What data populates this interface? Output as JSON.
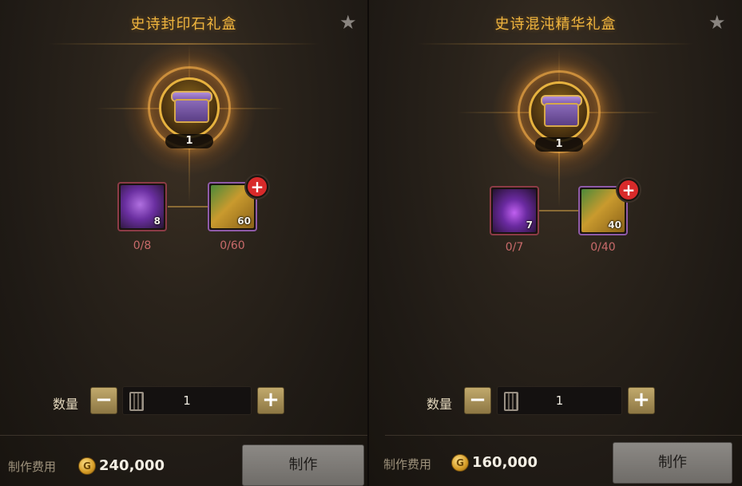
{
  "panels": [
    {
      "title": "史诗封印石礼盒",
      "main_count": "1",
      "materials": [
        {
          "count": "8",
          "progress": "0/8",
          "icon": "purple-crystal-icon"
        },
        {
          "count": "60",
          "progress": "0/60",
          "icon": "gold-bars-icon",
          "badge": "+"
        }
      ],
      "quantity_label": "数量",
      "quantity_value": "1",
      "minus": "−",
      "plus": "+",
      "cost_label": "制作费用",
      "cost_value": "240,000",
      "craft_label": "制作"
    },
    {
      "title": "史诗混沌精华礼盒",
      "main_count": "1",
      "materials": [
        {
          "count": "7",
          "progress": "0/7",
          "icon": "purple-essence-icon"
        },
        {
          "count": "40",
          "progress": "0/40",
          "icon": "gold-bars-icon",
          "badge": "+"
        }
      ],
      "quantity_label": "数量",
      "quantity_value": "1",
      "minus": "−",
      "plus": "+",
      "cost_label": "制作费用",
      "cost_value": "160,000",
      "craft_label": "制作"
    }
  ],
  "icons": {
    "star": "★",
    "coin": "G"
  },
  "colors": {
    "title": "#f0b53e",
    "progress_missing": "#c86a6a",
    "add_badge": "#d82a2a"
  }
}
